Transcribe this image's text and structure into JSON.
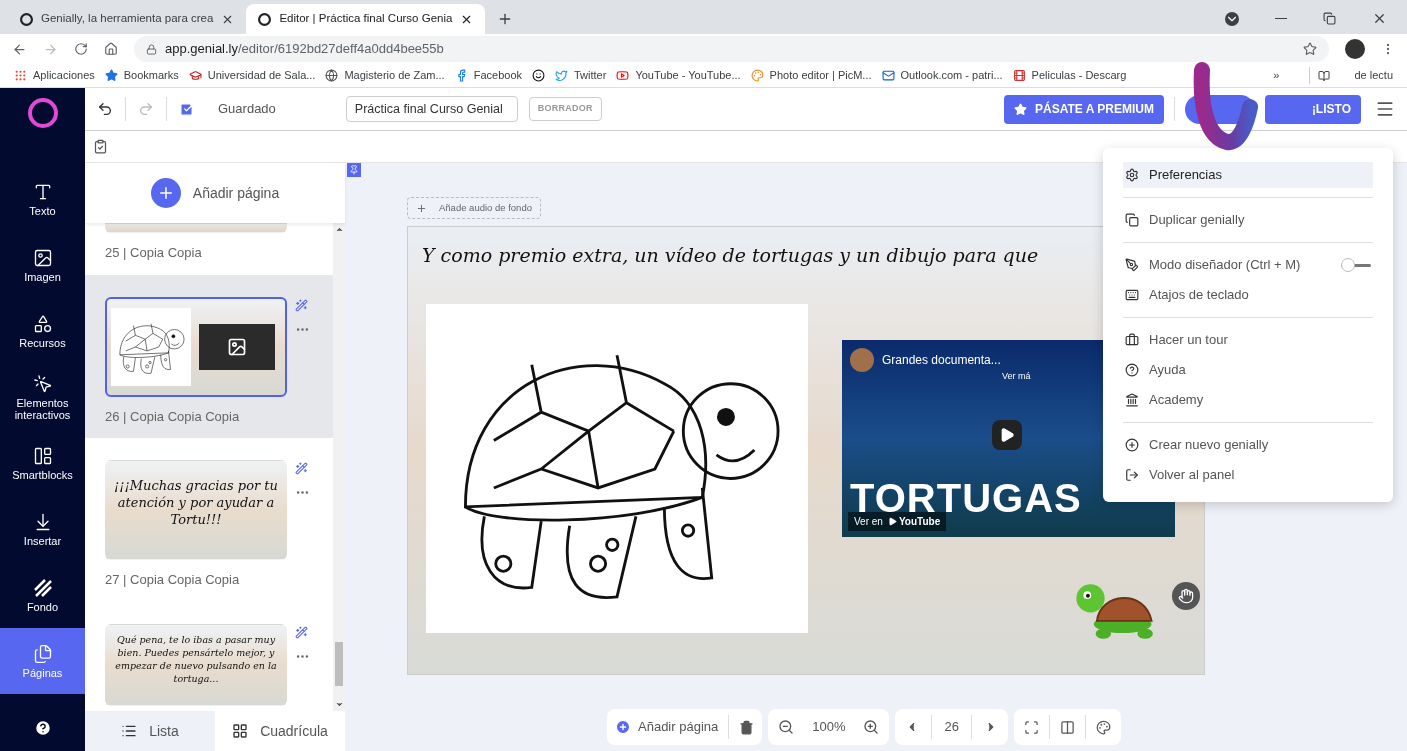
{
  "browser": {
    "tabs": [
      {
        "title": "Genially, la herramienta para crea",
        "selected": false
      },
      {
        "title": "Editor | Práctica final Curso Genia",
        "selected": true
      }
    ],
    "url_host": "app.genial.ly",
    "url_path": "/editor/6192bd27deff4a0dd4bee55b",
    "bookmarks": [
      {
        "kind": "apps",
        "label": "Aplicaciones"
      },
      {
        "kind": "star",
        "label": "Bookmarks"
      },
      {
        "kind": "university",
        "label": "Universidad de Sala..."
      },
      {
        "kind": "globe",
        "label": "Magisterio de Zam..."
      },
      {
        "kind": "facebook",
        "label": "Facebook"
      },
      {
        "kind": "app"
      },
      {
        "kind": "twitter",
        "label": "Twitter"
      },
      {
        "kind": "youtube",
        "label": "YouTube - YouTube..."
      },
      {
        "kind": "photo",
        "label": "Photo editor | PicM..."
      },
      {
        "kind": "outlook",
        "label": "Outlook.com - patri..."
      },
      {
        "kind": "movies",
        "label": "Peliculas - Descarg"
      }
    ],
    "bookmarks_overflow": "»",
    "reading_list": "de lectu"
  },
  "toolbar": {
    "saved_label": "Guardado",
    "title_value": "Práctica final Curso Genial",
    "status_badge": "BORRADOR",
    "premium_button": "PÁSATE A PREMIUM",
    "done_button": "¡LISTO"
  },
  "nav": [
    {
      "label": "Texto",
      "selected": false
    },
    {
      "label": "Imagen",
      "selected": false
    },
    {
      "label": "Recursos",
      "selected": false
    },
    {
      "label": "Elementos interactivos",
      "selected": false
    },
    {
      "label": "Smartblocks",
      "selected": false
    },
    {
      "label": "Insertar",
      "selected": false
    },
    {
      "label": "Fondo",
      "selected": false
    },
    {
      "label": "Páginas",
      "selected": true
    }
  ],
  "pages_panel": {
    "add_page": "Añadir página",
    "pages": [
      {
        "number": "25 |",
        "name": "Copia Copia",
        "selected": false,
        "kind": "partial"
      },
      {
        "number": "26 |",
        "name": "Copia Copia Copia",
        "selected": true,
        "kind": "media"
      },
      {
        "number": "27 |",
        "name": "Copia Copia Copia",
        "selected": false,
        "kind": "text",
        "thumbnail_text": "¡¡¡Muchas gracias por tu atención y por ayudar a Tortu!!!"
      },
      {
        "kind": "text_turtle",
        "selected": false,
        "thumbnail_text": "Qué pena, te lo ibas a pasar muy bien. Puedes pensártelo mejor, y empezar de nuevo pulsando en la tortuga..."
      }
    ],
    "views": [
      {
        "label": "Lista",
        "selected": true
      },
      {
        "label": "Cuadrícula",
        "selected": false
      }
    ]
  },
  "canvas": {
    "audio_button": "Añade audio de fondo",
    "heading": "Y como premio extra, un vídeo de tortugas y un dibujo para que",
    "video": {
      "channel": "Grandes documenta...",
      "more": "Ver má",
      "title": "TORTUGAS",
      "watch_on": "Ver en",
      "platform": "YouTube"
    }
  },
  "bottom_toolbar": {
    "add_page": "Añadir página",
    "zoom": "100%",
    "page": "26"
  },
  "menu": {
    "groups": [
      [
        {
          "label": "Preferencias",
          "kind": "item",
          "highlighted": true
        }
      ],
      [
        {
          "label": "Duplicar genially",
          "kind": "item",
          "highlighted": false
        }
      ],
      [
        {
          "label": "Modo diseñador (Ctrl + M)",
          "kind": "toggle",
          "on": false,
          "highlighted": false
        },
        {
          "label": "Atajos de teclado",
          "kind": "item",
          "highlighted": false
        }
      ],
      [
        {
          "label": "Hacer un tour",
          "kind": "item",
          "highlighted": false
        },
        {
          "label": "Ayuda",
          "kind": "item",
          "highlighted": false
        },
        {
          "label": "Academy",
          "kind": "item",
          "highlighted": false
        }
      ],
      [
        {
          "label": "Crear nuevo genially",
          "kind": "item",
          "highlighted": false
        },
        {
          "label": "Volver al panel",
          "kind": "item",
          "highlighted": false
        }
      ]
    ]
  }
}
